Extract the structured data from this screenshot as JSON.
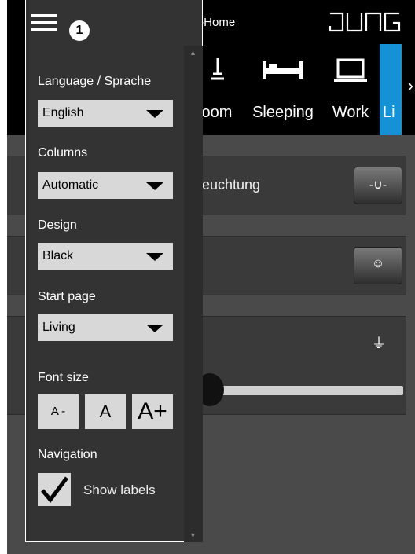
{
  "app": {
    "title": "SV-Home",
    "logo_text": "JUNG"
  },
  "menu": {
    "badge": "1"
  },
  "rooms": [
    {
      "label": "oom",
      "icon": "bathroom-icon"
    },
    {
      "label": "Sleeping",
      "icon": "bed-icon"
    },
    {
      "label": "Work",
      "icon": "laptop-icon"
    },
    {
      "label": "Li",
      "icon": "living-icon"
    }
  ],
  "rooms_more": "›",
  "content": {
    "row1_label": "euchtung",
    "row1_button": "-∪-",
    "row2_button": "☺",
    "row3_lamp": "⏚"
  },
  "settings": {
    "language": {
      "label": "Language / Sprache",
      "value": "English"
    },
    "columns": {
      "label": "Columns",
      "value": "Automatic"
    },
    "design": {
      "label": "Design",
      "value": "Black"
    },
    "start_page": {
      "label": "Start page",
      "value": "Living"
    },
    "font_size": {
      "label": "Font size",
      "smaller": "A -",
      "normal": "A",
      "larger": "A+"
    },
    "navigation": {
      "label": "Navigation",
      "show_labels": "Show labels",
      "show_labels_checked": true
    }
  },
  "colors": {
    "accent": "#1592d6",
    "panel": "#333333",
    "control": "#d8d8d8"
  }
}
